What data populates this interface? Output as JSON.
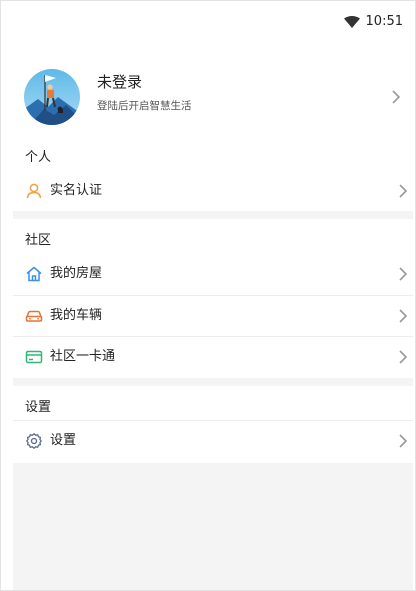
{
  "status_bar": {
    "time": "10:51",
    "icons": [
      "wifi-icon"
    ]
  },
  "profile": {
    "name": "未登录",
    "subtitle": "登陆后开启智慧生活",
    "avatar_icon": "mountain-climber-avatar"
  },
  "sections": {
    "personal": {
      "title": "个人",
      "items": [
        {
          "label": "实名认证",
          "icon": "user-icon",
          "icon_color": "#f0a040"
        }
      ]
    },
    "community": {
      "title": "社区",
      "items": [
        {
          "label": "我的房屋",
          "icon": "house-icon",
          "icon_color": "#3a8ee6"
        },
        {
          "label": "我的车辆",
          "icon": "car-icon",
          "icon_color": "#e8703a"
        },
        {
          "label": "社区一卡通",
          "icon": "card-icon",
          "icon_color": "#2fb874"
        }
      ]
    },
    "settings": {
      "title": "设置",
      "items": [
        {
          "label": "设置",
          "icon": "gear-icon",
          "icon_color": "#5a6a88"
        }
      ]
    }
  },
  "colors": {
    "background": "#ffffff",
    "section_gap": "#f4f4f4",
    "chevron": "#9a9a9a"
  }
}
